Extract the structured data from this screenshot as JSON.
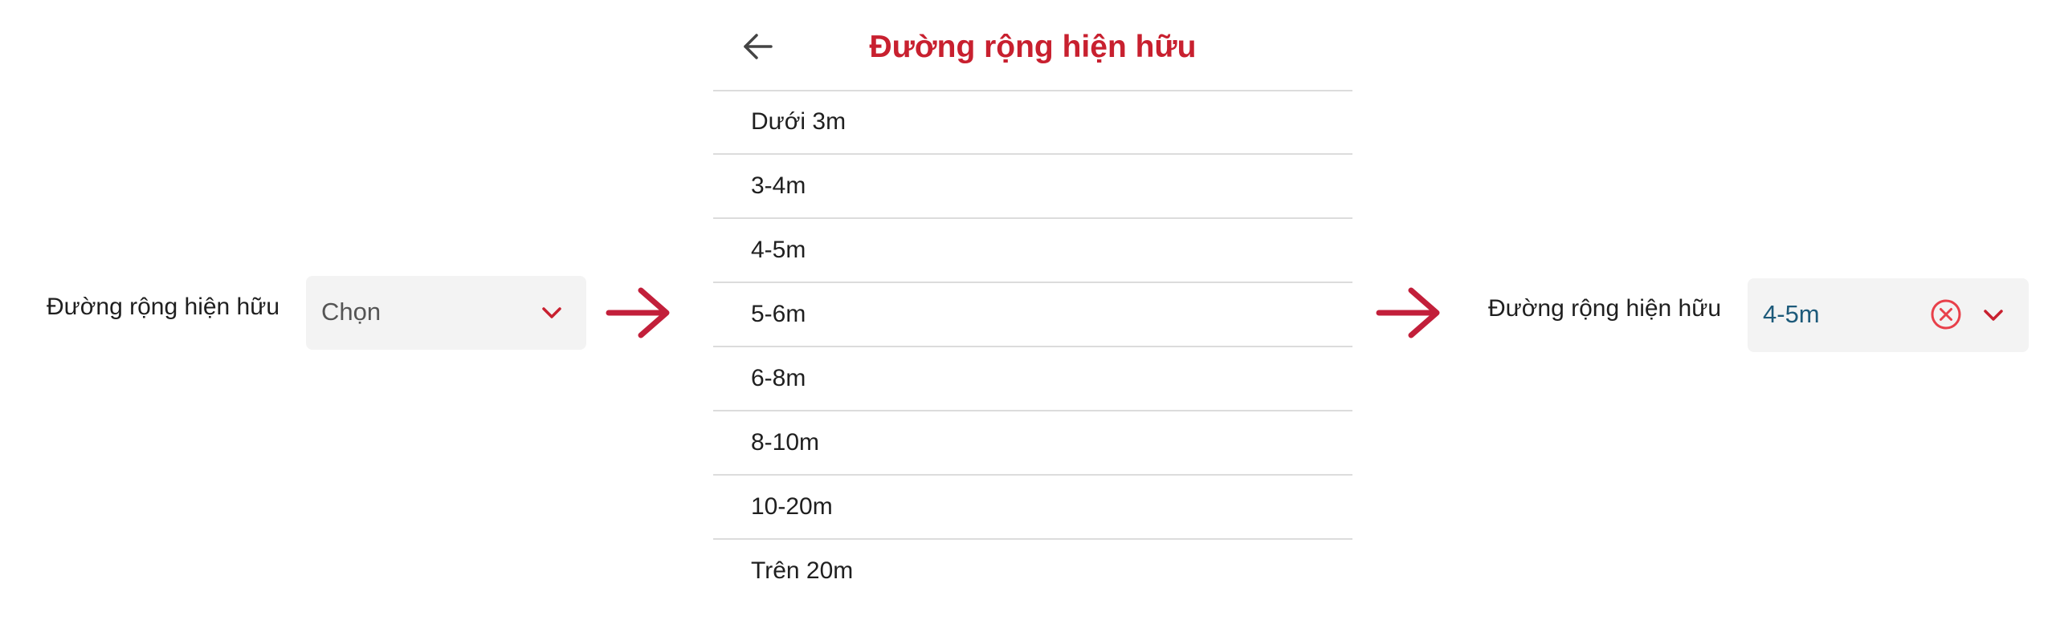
{
  "before": {
    "label": "Đường rộng hiện hữu",
    "placeholder": "Chọn",
    "chevron_icon": "chevron-down-icon"
  },
  "sheet": {
    "title": "Đường rộng hiện hữu",
    "back_icon": "arrow-left-icon",
    "options": [
      {
        "label": "Dưới 3m"
      },
      {
        "label": "3-4m"
      },
      {
        "label": "4-5m"
      },
      {
        "label": "5-6m"
      },
      {
        "label": "6-8m"
      },
      {
        "label": "8-10m"
      },
      {
        "label": "10-20m"
      },
      {
        "label": "Trên 20m"
      }
    ]
  },
  "after": {
    "label": "Đường rộng hiện hữu",
    "value": "4-5m",
    "clear_icon": "clear-circle-icon",
    "chevron_icon": "chevron-down-icon"
  },
  "flow_arrow_icon": "arrow-right-icon",
  "colors": {
    "accent_red": "#c8202f",
    "selected_value": "#1d5a7a",
    "field_background": "#f3f3f3",
    "divider": "#dcdcdc",
    "text": "#1f1f1f"
  }
}
